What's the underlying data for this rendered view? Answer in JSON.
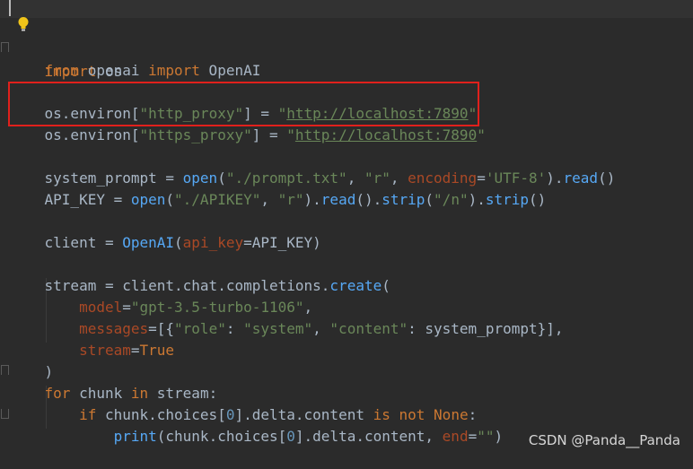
{
  "colors": {
    "background": "#2b2b2b",
    "keyword": "#cc7832",
    "string": "#6a8759",
    "function": "#56a8f5",
    "parameter": "#aa4926",
    "plain": "#a9b7c6",
    "annotation_box": "#e0201c"
  },
  "icons": {
    "intention": "lightbulb-icon"
  },
  "code": {
    "l1": {
      "kw_import": "import",
      "mod": " os"
    },
    "l3": {
      "kw_from": "from",
      "mod": " openai ",
      "kw_import": "import",
      "cls": " OpenAI"
    },
    "l5": {
      "pre": "os.environ[",
      "key": "\"http_proxy\"",
      "eq": "] = ",
      "q1": "\"",
      "url": "http://localhost:7890",
      "q2": "\""
    },
    "l6": {
      "pre": "os.environ[",
      "key": "\"https_proxy\"",
      "eq": "] = ",
      "q1": "\"",
      "url": "http://localhost:7890",
      "q2": "\""
    },
    "l8": {
      "a": "system_prompt = ",
      "open": "open",
      "b": "(",
      "path": "\"./prompt.txt\"",
      "c": ", ",
      "mode": "\"r\"",
      "d": ", ",
      "enc": "encoding",
      "e": "=",
      "utf": "'UTF-8'",
      "f": ").",
      "read": "read",
      "g": "()"
    },
    "l9": {
      "a": "API_KEY = ",
      "open": "open",
      "b": "(",
      "path": "\"./APIKEY\"",
      "c": ", ",
      "mode": "\"r\"",
      "d": ").",
      "read": "read",
      "e": "().",
      "strip1": "strip",
      "f": "(",
      "nl": "\"/n\"",
      "g": ").",
      "strip2": "strip",
      "h": "()"
    },
    "l11": {
      "a": "client = ",
      "cls": "OpenAI",
      "b": "(",
      "param": "api_key",
      "c": "=API_KEY)"
    },
    "l13": {
      "a": "stream = client.chat.completions.",
      "create": "create",
      "b": "("
    },
    "l14": {
      "indent": "    ",
      "param": "model",
      "eq": "=",
      "val": "\"gpt-3.5-turbo-1106\"",
      "end": ","
    },
    "l15": {
      "indent": "    ",
      "param": "messages",
      "eq": "=[{",
      "k1": "\"role\"",
      "c1": ": ",
      "v1": "\"system\"",
      "c2": ", ",
      "k2": "\"content\"",
      "c3": ": system_prompt}],"
    },
    "l16": {
      "indent": "    ",
      "param": "stream",
      "eq": "=",
      "val": "True"
    },
    "l17": {
      "text": ")"
    },
    "l18": {
      "kw_for": "for",
      "a": " chunk ",
      "kw_in": "in",
      "b": " stream:"
    },
    "l19": {
      "indent": "    ",
      "kw_if": "if",
      "a": " chunk.choices[",
      "n0": "0",
      "b": "].delta.content ",
      "kw_is": "is",
      "sp1": " ",
      "kw_not": "not",
      "sp2": " ",
      "kw_none": "None",
      "c": ":"
    },
    "l20": {
      "indent": "        ",
      "print": "print",
      "a": "(chunk.choices[",
      "n0": "0",
      "b": "].delta.content, ",
      "param": "end",
      "eq": "=",
      "val": "\"\"",
      "c": ")"
    }
  },
  "watermark": "CSDN @Panda__Panda"
}
